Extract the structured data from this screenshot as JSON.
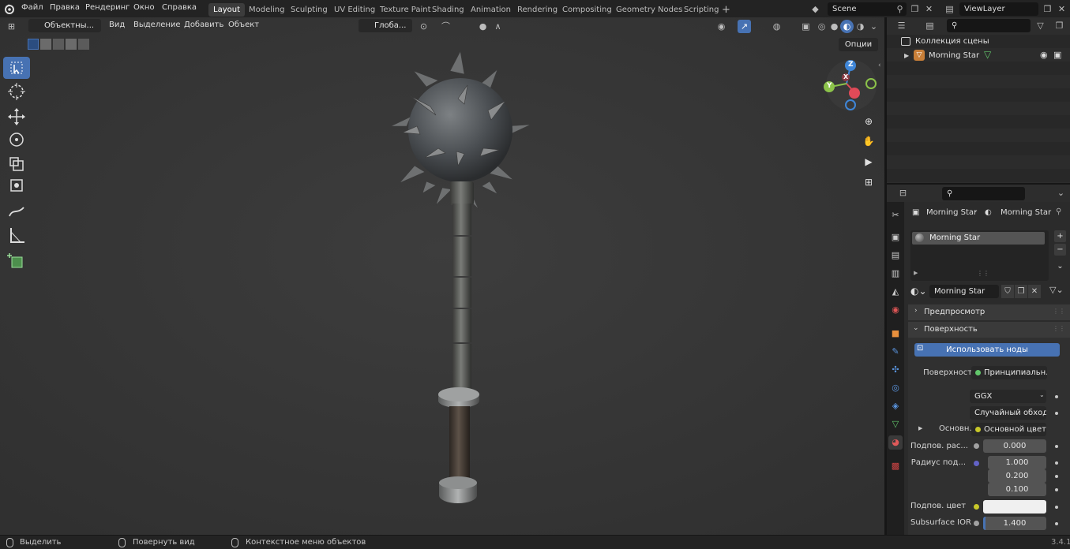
{
  "topbar": {
    "menu": [
      "Файл",
      "Правка",
      "Рендеринг",
      "Окно",
      "Справка"
    ],
    "workspaces": [
      "Layout",
      "Modeling",
      "Sculpting",
      "UV Editing",
      "Texture Paint",
      "Shading",
      "Animation",
      "Rendering",
      "Compositing",
      "Geometry Nodes",
      "Scripting"
    ],
    "active_workspace": "Layout",
    "add_tab": "+",
    "scene": "Scene",
    "view_layer": "ViewLayer"
  },
  "viewport": {
    "mode": "Объектны...",
    "menus": [
      "Вид",
      "Выделение",
      "Добавить",
      "Объект"
    ],
    "orientation": "Глоба...",
    "options": "Опции",
    "gizmo_labels": {
      "x": "X",
      "y": "Y",
      "z": "Z"
    }
  },
  "outliner": {
    "collection": "Коллекция сцены",
    "object": "Morning Star"
  },
  "properties": {
    "breadcrumb_object": "Morning Star",
    "breadcrumb_material": "Morning Star",
    "slot_name": "Morning Star",
    "material_name": "Morning Star",
    "panel_preview": "Предпросмотр",
    "panel_surface": "Поверхность",
    "use_nodes": "Использовать ноды",
    "surface_label": "Поверхность",
    "surface_value": "Принципиальн...",
    "distribution": "GGX",
    "subsurface_method": "Случайный обход",
    "base_color_label": "Основн...",
    "base_color_value": "Основной цвет",
    "subsurface_label": "Подпов. рас...",
    "subsurface_value": "0.000",
    "radius_label": "Радиус под...",
    "radius_values": [
      "1.000",
      "0.200",
      "0.100"
    ],
    "subsurface_color_label": "Подпов. цвет",
    "subsurface_color": "#f0f0f0",
    "ior_label": "Subsurface IOR",
    "ior_value": "1.400",
    "ior_fill": 0.04
  },
  "statusbar": {
    "select": "Выделить",
    "rotate": "Повернуть вид",
    "context": "Контекстное меню объектов",
    "version": "3.4.1"
  },
  "colors": {
    "accent": "#4772b3",
    "axis_x": "#e04a58",
    "axis_y": "#8cc34a",
    "axis_z": "#3f86d8",
    "socket_green": "#62c76b",
    "socket_yellow": "#c7c729",
    "socket_gray": "#a1a1a1",
    "socket_purple": "#6363c7"
  }
}
